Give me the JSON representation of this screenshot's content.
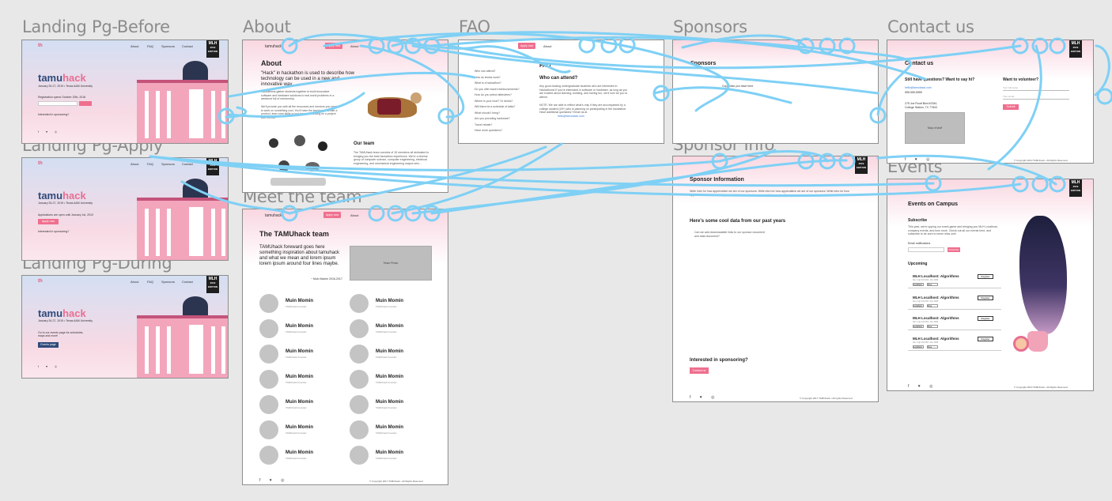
{
  "canvas": {
    "background": "#e8e8e8",
    "wire_color": "#7fd0f5"
  },
  "boards": {
    "landing_before": {
      "label": "Landing Pg-Before",
      "nav": [
        "About",
        "FAQ",
        "Sponsors",
        "Contact"
      ],
      "mlh": "MLH",
      "edition": "2019 EDITION",
      "brand_a": "tamu",
      "brand_b": "hack",
      "date": "January 26-27, 2019 • Texas A&M University",
      "reg": "Registration opens October 20th, 2018",
      "interest": "Interested in sponsoring?"
    },
    "landing_apply": {
      "label": "Landing Pg-Apply",
      "nav": [
        "About",
        "FAQ",
        "Sponsors",
        "Contact"
      ],
      "mlh": "MLH",
      "edition": "2019 EDITION",
      "brand_a": "tamu",
      "brand_b": "hack",
      "date": "January 26-27, 2019 • Texas A&M University",
      "reg": "Applications are open until January 1st, 2019",
      "cta": "Apply now",
      "interest": "Interested in sponsoring?"
    },
    "landing_during": {
      "label": "Landing Pg-During",
      "nav": [
        "About",
        "FAQ",
        "Sponsors",
        "Contact"
      ],
      "mlh": "MLH",
      "edition": "2019 EDITION",
      "brand_a": "tamu",
      "brand_b": "hack",
      "date": "January 26-27, 2019 • Texas A&M University",
      "reg": "Go to our events page for schedules, maps and more!",
      "cta": "Events page"
    },
    "about": {
      "label": "About",
      "nav_logo": "tamuhack",
      "apply": "Apply now",
      "nav_link": "About",
      "title": "About",
      "lead": "\"Hack\" in hackathon is used to describe how technology can be used in a new and innovative way.",
      "body": "Hackathons gather students together to build innovative software and hardware solutions to real world problems in a weekend full of mentorship.",
      "body2": "We'll provide you with all the resources and mentors you need to work on something cool. You'll have the freedom to create a product, learn new skills or just have fun working on a project with friends.",
      "team_title": "Our team",
      "team_body": "The TAMUhack team consists of 15 members all dedicated to bringing you the best hackathon experience. We're a diverse group of computer science, computer engineering, electrical engineering, and mechanical engineering majors who..."
    },
    "meet_team": {
      "label": "Meet the team",
      "nav_logo": "tamuhack",
      "apply": "Apply now",
      "nav_link": "About",
      "title": "The TAMUhack team",
      "quote": "TAMUhack foreward goes here something inspiration about tamuhack and what we mean and lorem ipsum lorem ipsum around four lines maybe.",
      "quote_by": "~ Muin Momin 2016-2017",
      "photo": "Team Photo",
      "member_name": "Muin Momin",
      "member_role": "TAMUhack Founder",
      "footer_icons": "f ♥ ◎",
      "copyright": "© Copyright 2017 TAMUhack • All Rights Reserved"
    },
    "faq": {
      "label": "FAQ",
      "apply": "Apply now",
      "nav_link": "About",
      "title": "FAQ",
      "question": "Who can attend?",
      "answer": "Any good-looking undergraduate students who are interested in Hackathons! If you're interested in software or hardware, as long as you are excited about learning, building, and having fun, we'd love for you to attend.",
      "note": "NOTE: We are able to reflect what's only if they are accompanied by a college student (18+) who is planning on participating in the hackathon. Have additional questions? Email us at",
      "email": "hello@tamuhack.com",
      "questions": [
        "Who can attend?",
        "How do teams work?",
        "What is a hackathon?",
        "Do you offer travel reimbursements?",
        "How do you select attendees?",
        "Where is your food? Or drinks?",
        "Will there be a schedule of talks?",
        "What should I bring?",
        "Are you providing hardware?",
        "Travel rebate?",
        "Have more questions?"
      ]
    },
    "sponsors": {
      "label": "Sponsors",
      "title": "Sponsors",
      "apply": "Apply now",
      "caption": "Copy links you have here"
    },
    "sponsor_info": {
      "label": "Sponsor Info",
      "title": "Sponsor Information",
      "apply": "Apply now",
      "mlh": "MLH",
      "edition": "2019 EDITION",
      "intro": "Write intro for how appreciative we are of our sponsors. Write intro for how appreciative we are of our sponsors. Write intro for how appreciative we are of our sponsors. Write intro for how appreciative we are of our sponsors.",
      "data_title": "Here's some cool data from our past years",
      "data_note": "Can we add downloadable links to our sponsor document and data document?",
      "interest": "Interested in sponsoring?",
      "cta": "Contact us",
      "footer_icons": "f ♥ ◎",
      "copyright": "© Copyright 2017 TAMUhack • All rights Reserved"
    },
    "contact": {
      "label": "Contact us",
      "title": "Contact us",
      "mlh": "MLH",
      "edition": "2019 EDITION",
      "q1": "Still have questions? Want to say hi?",
      "email": "hello@tamuhack.com",
      "phone": "555-555-5555",
      "address1": "275 Joe Routt Blvd #2340,",
      "address2": "College Station, TX 77843",
      "map": "Map of stuff",
      "q2": "Want to volunteer?",
      "field1": "Your full name",
      "field2": "Your email",
      "submit": "Submit",
      "footer_icons": "f ♥ ◎",
      "copyright": "© Copyright 2019 TAMUhack • All Rights Reserved"
    },
    "events": {
      "label": "Events",
      "mlh": "MLH",
      "edition": "2019 EDITION",
      "title": "Events on Campus",
      "subscribe": "Subscribe",
      "sub_body": "This year, we're upping our event-game and bringing you MLH Localhost, company events, and tons more. Check out all our events here, and subscribe to be sure to never miss one!",
      "email_label": "Email notifications",
      "sub_btn": "Subscribe",
      "upcoming": "Upcoming",
      "event_title": "MLH Localhost: Algorithms",
      "event_meta": "Nov 4 @ 6:00 PM • Rm 2005",
      "register": "Register",
      "tags": [
        "Localhost",
        "Free"
      ],
      "footer_icons": "f ♥ ◎",
      "copyright": "© Copyright 2019 TAMUhack • All Rights Reserved"
    }
  }
}
